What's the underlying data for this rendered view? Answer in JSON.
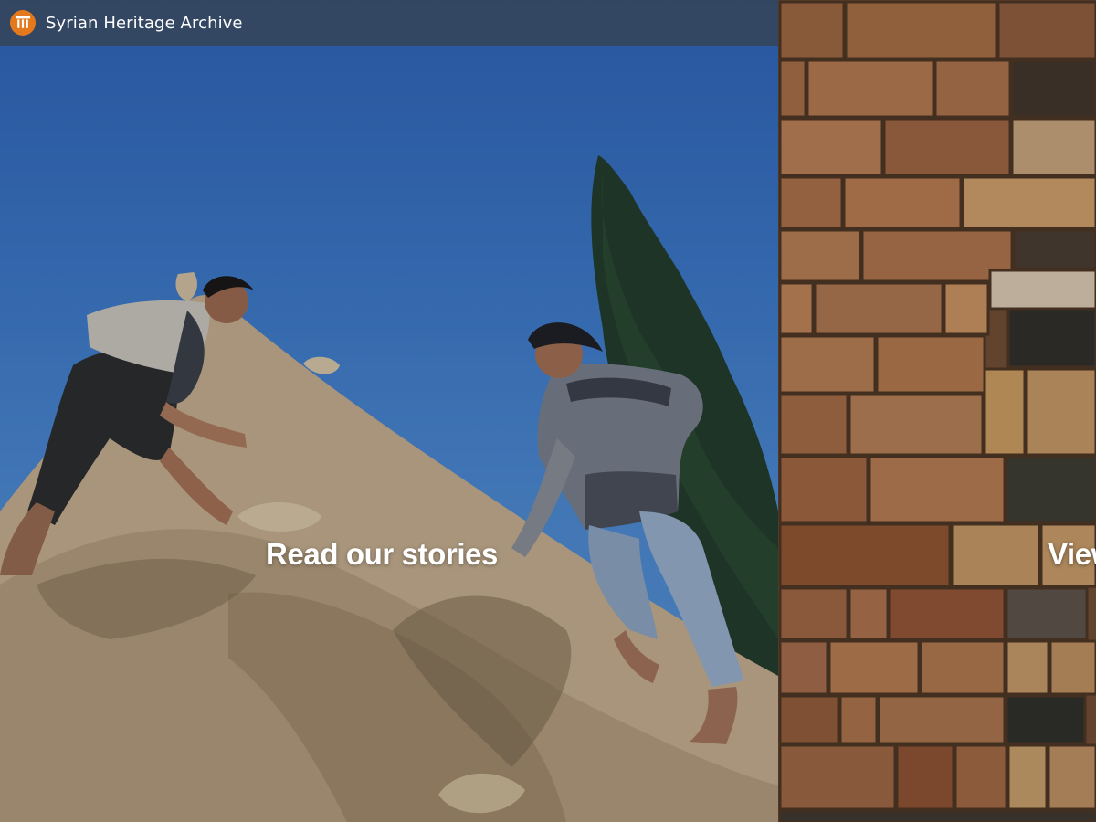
{
  "header": {
    "site_title": "Syrian Heritage Archive",
    "logo_icon": "columns-logo-icon",
    "accent_color": "#e4781c"
  },
  "panels": [
    {
      "label": "Read our stories",
      "image": "men-climbing-beehive-dome-photo"
    },
    {
      "label": "View the collection",
      "image": "stone-brick-wall-photo"
    }
  ]
}
